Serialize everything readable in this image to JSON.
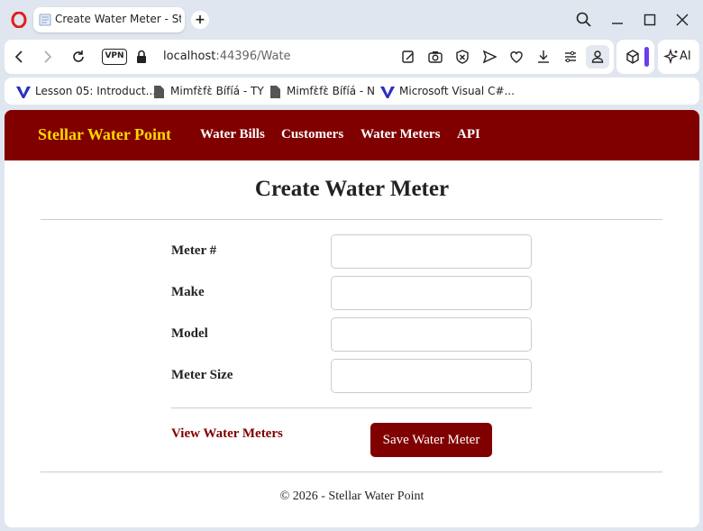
{
  "browser": {
    "tab_title": "Create Water Meter - Stellar Water Point",
    "new_tab_label": "+",
    "vpn_label": "VPN",
    "url_host": "localhost",
    "url_path": ":44396/Wate",
    "ai_label": "AI",
    "accent_color": "#6a3cf0"
  },
  "bookmarks": [
    {
      "label": "Lesson 05: Introduct...",
      "icon": "vs-icon"
    },
    {
      "label": "Mimfɛ̀fɛ̀ Bífíá - TY",
      "icon": "doc-icon"
    },
    {
      "label": "Mimfɛ̀fɛ̀ Bífíá - N",
      "icon": "doc-icon"
    },
    {
      "label": "Microsoft Visual C#...",
      "icon": "vs-icon"
    }
  ],
  "navbar": {
    "brand": "Stellar Water Point",
    "links": [
      "Water Bills",
      "Customers",
      "Water Meters",
      "API"
    ],
    "background": "#800000",
    "brand_color": "#ffd700"
  },
  "main": {
    "title": "Create Water Meter",
    "fields": [
      {
        "label": "Meter #",
        "value": ""
      },
      {
        "label": "Make",
        "value": ""
      },
      {
        "label": "Model",
        "value": ""
      },
      {
        "label": "Meter Size",
        "value": ""
      }
    ],
    "back_link": "View Water Meters",
    "save_button": "Save Water Meter"
  },
  "footer": {
    "text": "© 2026 - Stellar Water Point"
  }
}
